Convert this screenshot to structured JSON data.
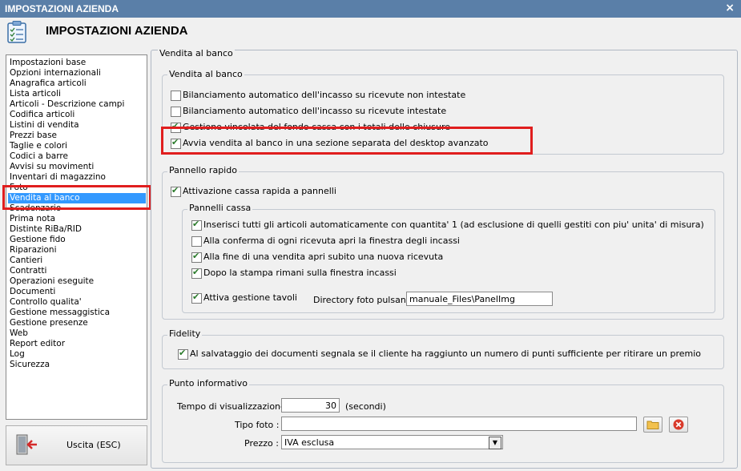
{
  "window": {
    "title": "IMPOSTAZIONI AZIENDA",
    "close_glyph": "×"
  },
  "header": {
    "title": "IMPOSTAZIONI AZIENDA",
    "icon": "checklist-icon"
  },
  "nav": {
    "items": [
      "Impostazioni base",
      "Opzioni internazionali",
      "Anagrafica articoli",
      "Lista articoli",
      "Articoli - Descrizione campi",
      "Codifica articoli",
      "Listini di vendita",
      "Prezzi base",
      "Taglie e colori",
      "Codici a barre",
      "Avvisi su movimenti",
      "Inventari di magazzino",
      "Foto",
      "Vendita al banco",
      "Scadenzario",
      "Prima nota",
      "Distinte RiBa/RID",
      "Gestione fido",
      "Riparazioni",
      "Cantieri",
      "Contratti",
      "Operazioni eseguite",
      "Documenti",
      "Controllo qualita'",
      "Gestione messaggistica",
      "Gestione presenze",
      "Web",
      "Report editor",
      "Log",
      "Sicurezza"
    ],
    "selected": "Vendita al banco"
  },
  "exit": {
    "label": "Uscita (ESC)",
    "icon": "exit-door-icon"
  },
  "main": {
    "title": "Vendita al banco",
    "vendita": {
      "title": "Vendita al banco",
      "opt1": "Bilanciamento automatico dell'incasso su ricevute non intestate",
      "opt2": "Bilanciamento automatico dell'incasso su ricevute intestate",
      "opt3": "Gestione vincolata del fondo cassa con i totali delle chiusure",
      "opt4": "Avvia vendita al banco in una sezione separata del desktop avanzato"
    },
    "rapido": {
      "title": "Pannello rapido",
      "attiva": "Attivazione cassa rapida a pannelli",
      "pannelli_title": "Pannelli cassa",
      "p1": "Inserisci tutti gli articoli automaticamente con quantita' 1 (ad esclusione di quelli gestiti con piu' unita' di misura)",
      "p2": "Alla conferma di ogni ricevuta apri la finestra degli incassi",
      "p3": "Alla fine di una vendita apri subito una nuova ricevuta",
      "p4": "Dopo la stampa rimani sulla finestra incassi",
      "tavoli": "Attiva gestione tavoli",
      "dir_label": "Directory foto pulsanti :",
      "dir_value": "manuale_Files\\PanelImg"
    },
    "fidelity": {
      "title": "Fidelity",
      "opt": "Al salvataggio dei documenti segnala se il cliente ha raggiunto un numero di punti sufficiente per ritirare un premio"
    },
    "punto": {
      "title": "Punto informativo",
      "tempo_label": "Tempo di visualizzazione :",
      "tempo_value": "30",
      "tempo_unit": "(secondi)",
      "tipo_label": "Tipo foto :",
      "tipo_value": "",
      "prezzo_label": "Prezzo :",
      "prezzo_value": "IVA esclusa"
    }
  }
}
